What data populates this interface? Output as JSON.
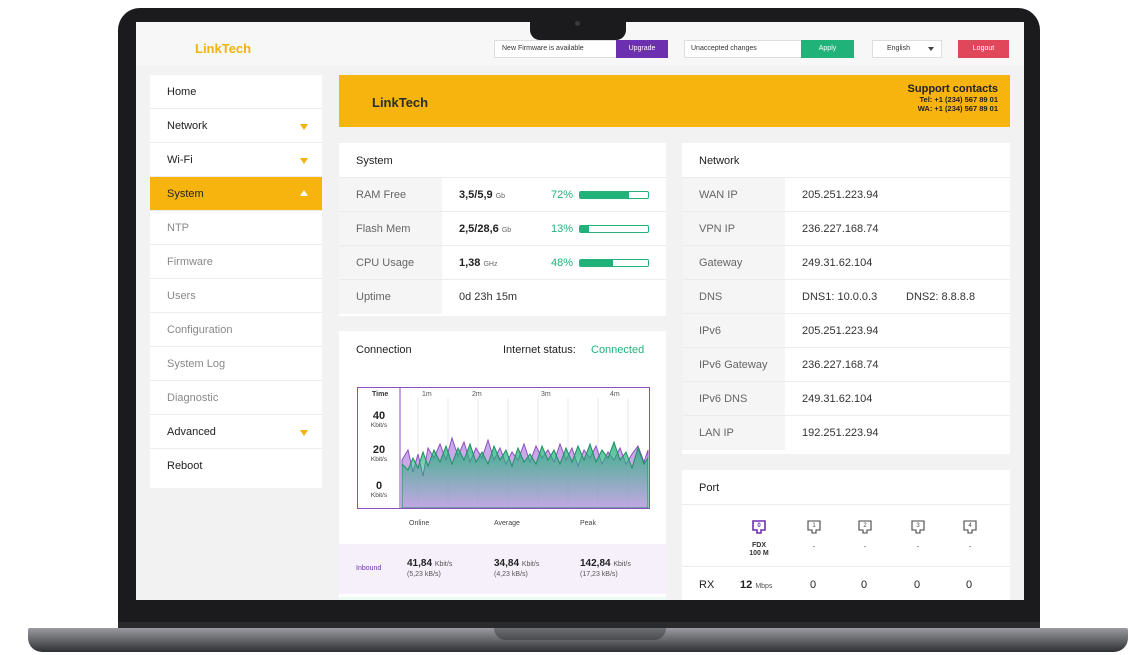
{
  "brand": {
    "name": "LinkTech",
    "accent": "#f7b40f",
    "purple": "#6c2fb0",
    "green": "#21b27a",
    "red": "#e0475a"
  },
  "topbar": {
    "firmware_text": "New Firmware is available",
    "upgrade_label": "Upgrade",
    "changes_text": "Unaccepted changes",
    "apply_label": "Apply",
    "language": "English",
    "logout_label": "Logout"
  },
  "sidebar": {
    "items": [
      {
        "label": "Home"
      },
      {
        "label": "Network",
        "icon": "chevron-down-icon"
      },
      {
        "label": "Wi-Fi",
        "icon": "chevron-down-icon"
      },
      {
        "label": "System",
        "icon": "chevron-up-icon",
        "active": true
      },
      {
        "label": "NTP"
      },
      {
        "label": "Firmware"
      },
      {
        "label": "Users"
      },
      {
        "label": "Configuration"
      },
      {
        "label": "System Log"
      },
      {
        "label": "Diagnostic"
      },
      {
        "label": "Advanced",
        "icon": "chevron-down-icon"
      },
      {
        "label": "Reboot"
      }
    ]
  },
  "banner": {
    "title": "LinkTech",
    "support_heading": "Support contacts",
    "tel": "Tel: +1 (234) 567 89 01",
    "wa": "WA:  +1 (234) 567 89 01"
  },
  "system": {
    "title": "System",
    "rows": [
      {
        "label": "RAM Free",
        "value": "3,5/5,9",
        "unit": "Gb",
        "percent": "72%",
        "fill": 0.72
      },
      {
        "label": "Flash Mem",
        "value": "2,5/28,6",
        "unit": "Gb",
        "percent": "13%",
        "fill": 0.13
      },
      {
        "label": "CPU Usage",
        "value": "1,38",
        "unit": "GHz",
        "percent": "48%",
        "fill": 0.48
      },
      {
        "label": "Uptime",
        "value": "0d 23h 15m"
      }
    ]
  },
  "connection": {
    "title": "Connection",
    "status_label": "Internet status:",
    "status_value": "Connected",
    "chart": {
      "time_label": "Time",
      "x_ticks": [
        "1m",
        "2m",
        "3m",
        "4m"
      ],
      "y_ticks": [
        {
          "value": "40",
          "unit": "Kbit/s"
        },
        {
          "value": "20",
          "unit": "Kbit/s"
        },
        {
          "value": "0",
          "unit": "Kbit/s"
        }
      ]
    },
    "legend": [
      "Online",
      "Average",
      "Peak"
    ],
    "inbound": {
      "label": "Inbound",
      "online": "41,84",
      "online_unit": "Kbit/s",
      "online_sub": "(5,23 kB/s)",
      "average": "34,84",
      "average_unit": "Kbit/s",
      "average_sub": "(4,23 kB/s)",
      "peak": "142,84",
      "peak_unit": "Kbit/s",
      "peak_sub": "(17,23 kB/s)"
    }
  },
  "network": {
    "title": "Network",
    "rows": [
      {
        "label": "WAN IP",
        "value": "205.251.223.94"
      },
      {
        "label": "VPN IP",
        "value": "236.227.168.74"
      },
      {
        "label": "Gateway",
        "value": "249.31.62.104"
      },
      {
        "label": "DNS",
        "value": "DNS1: 10.0.0.3",
        "value2": "DNS2: 8.8.8.8"
      },
      {
        "label": "IPv6",
        "value": "205.251.223.94"
      },
      {
        "label": "IPv6 Gateway",
        "value": "236.227.168.74"
      },
      {
        "label": "IPv6 DNS",
        "value": "249.31.62.104"
      },
      {
        "label": "LAN IP",
        "value": "192.251.223.94"
      }
    ]
  },
  "port": {
    "title": "Port",
    "ports": [
      {
        "num": "0",
        "status": "FDX",
        "speed": "100 M",
        "active": true
      },
      {
        "num": "1",
        "status": "-"
      },
      {
        "num": "2",
        "status": "-"
      },
      {
        "num": "3",
        "status": "-"
      },
      {
        "num": "4",
        "status": "-"
      }
    ],
    "rx_label": "RX",
    "rx_value": "12",
    "rx_unit": "Mbps",
    "rx_ports": [
      "0",
      "0",
      "0",
      "0"
    ]
  }
}
